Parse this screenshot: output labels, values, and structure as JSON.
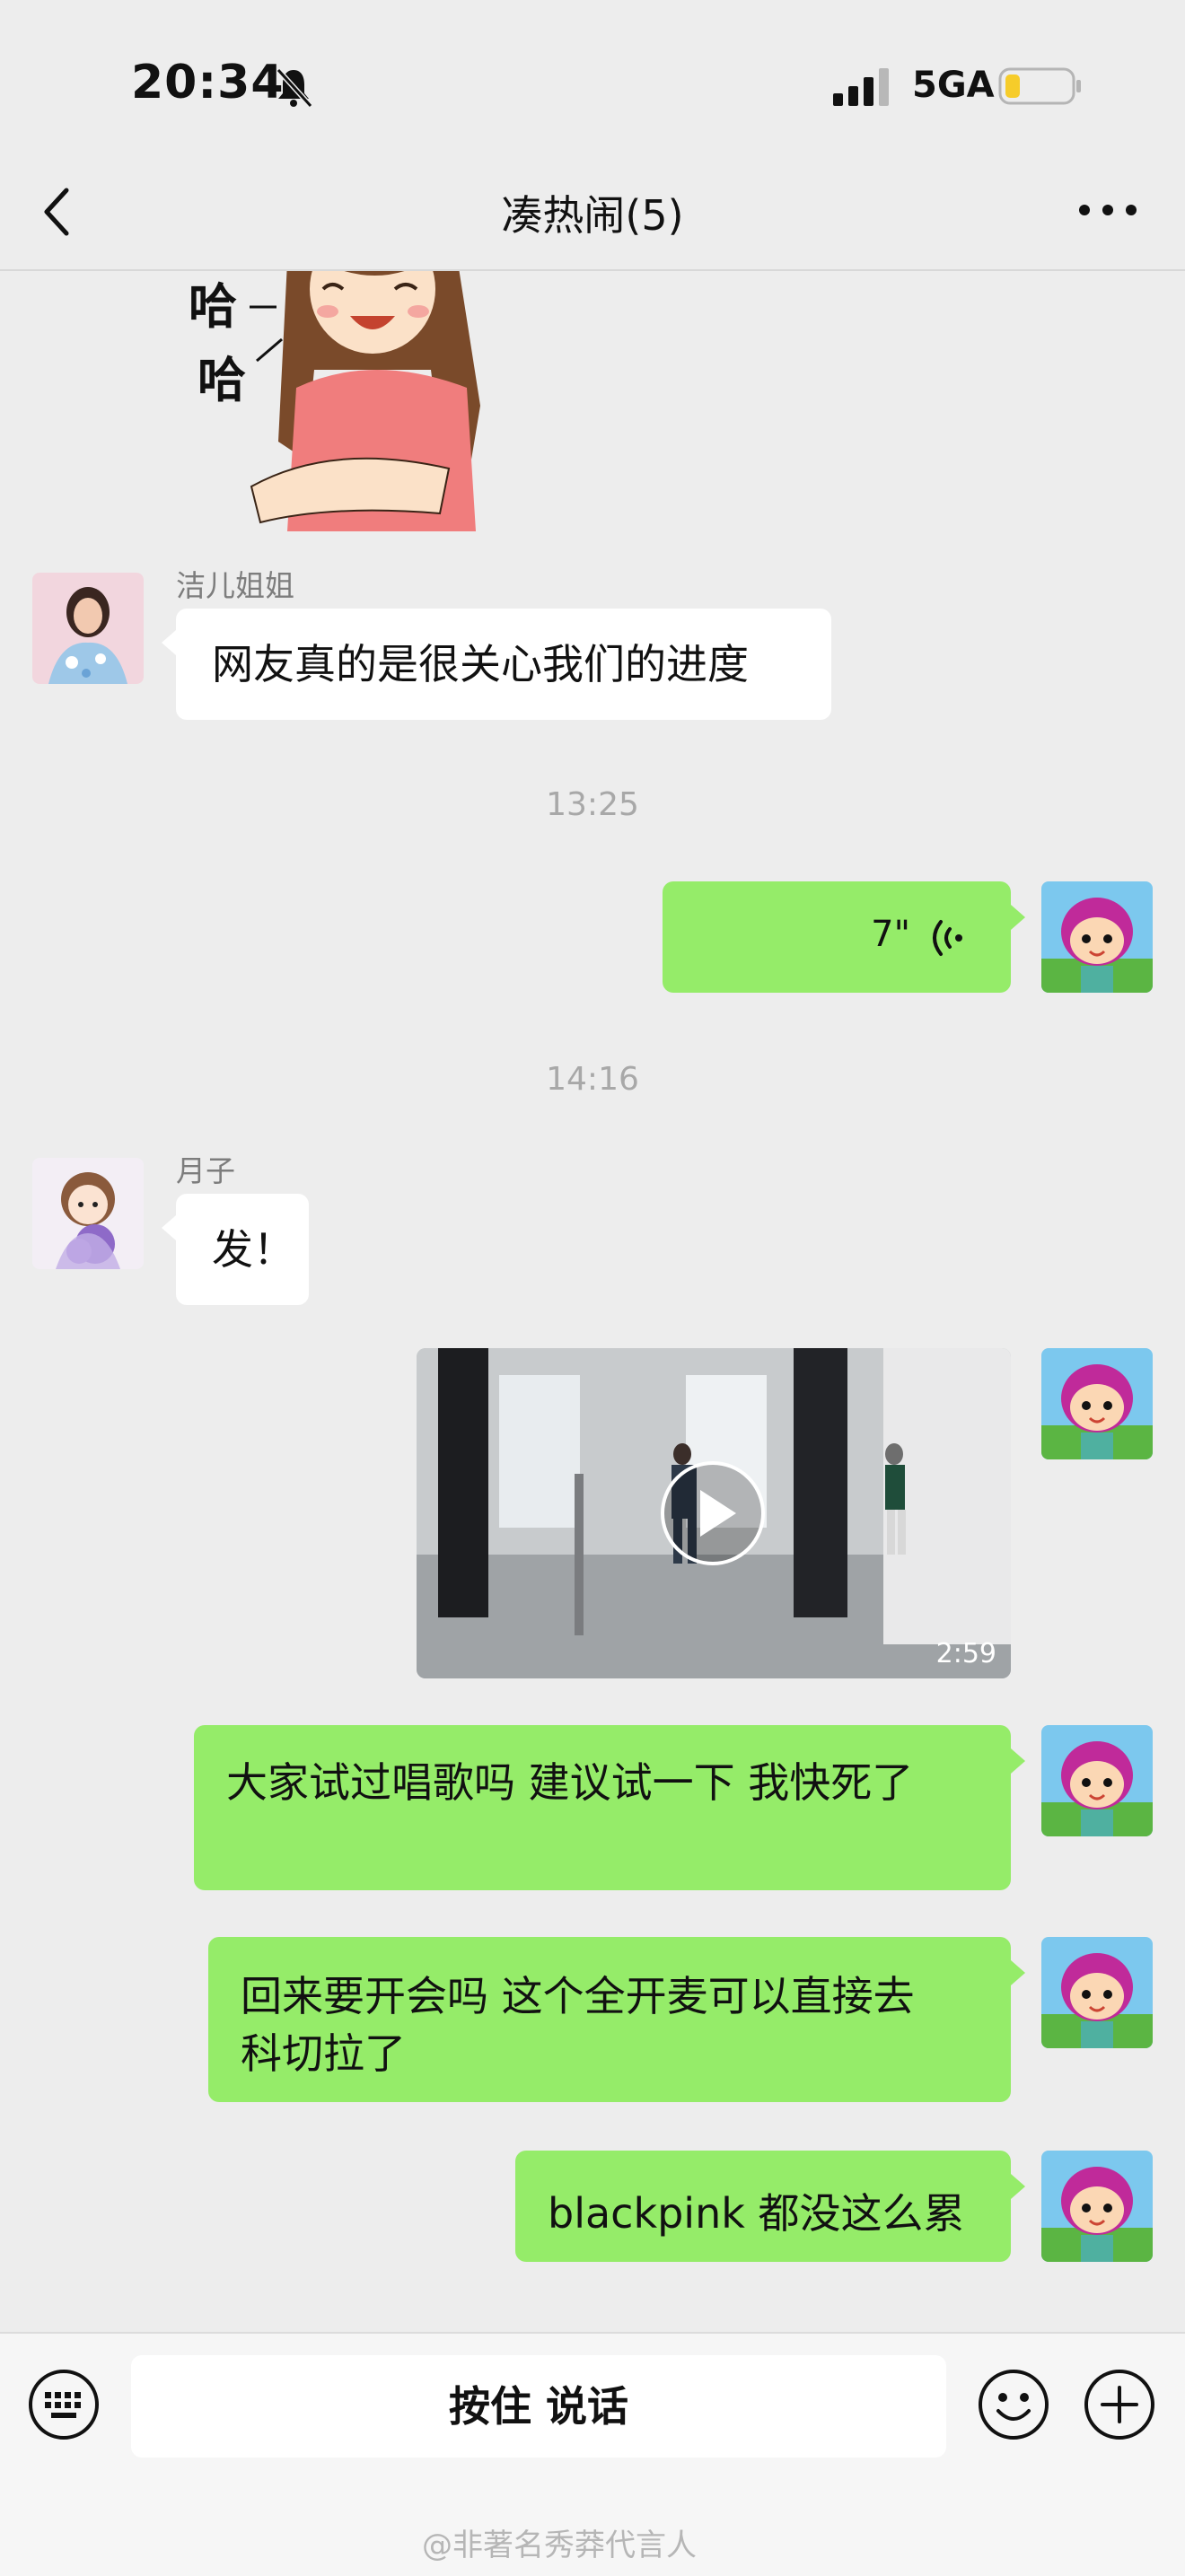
{
  "status_bar": {
    "time": "20:34",
    "network": "5GA"
  },
  "header": {
    "title": "凑热闹(5)"
  },
  "sticker": {
    "text_1": "哈",
    "text_2": "哈"
  },
  "messages": [
    {
      "sender": "洁儿姐姐",
      "text": "网友真的是很关心我们的进度"
    },
    {
      "timestamp": "13:25"
    },
    {
      "voice_duration": "7\""
    },
    {
      "timestamp": "14:16"
    },
    {
      "sender": "月子",
      "text": "发！"
    },
    {
      "video_duration": "2:59"
    },
    {
      "text": "大家试过唱歌吗 建议试一下 我快死了"
    },
    {
      "text_line1": "回来要开会吗 这个全开麦可以直接去",
      "text_line2": "科切拉了"
    },
    {
      "text": "blackpink 都没这么累"
    }
  ],
  "input": {
    "talk_label": "按住 说话"
  },
  "watermark": "@非著名秀莽代言人",
  "colors": {
    "outgoing_bubble": "#95ec69",
    "incoming_bubble": "#ffffff",
    "background": "#ededed"
  }
}
